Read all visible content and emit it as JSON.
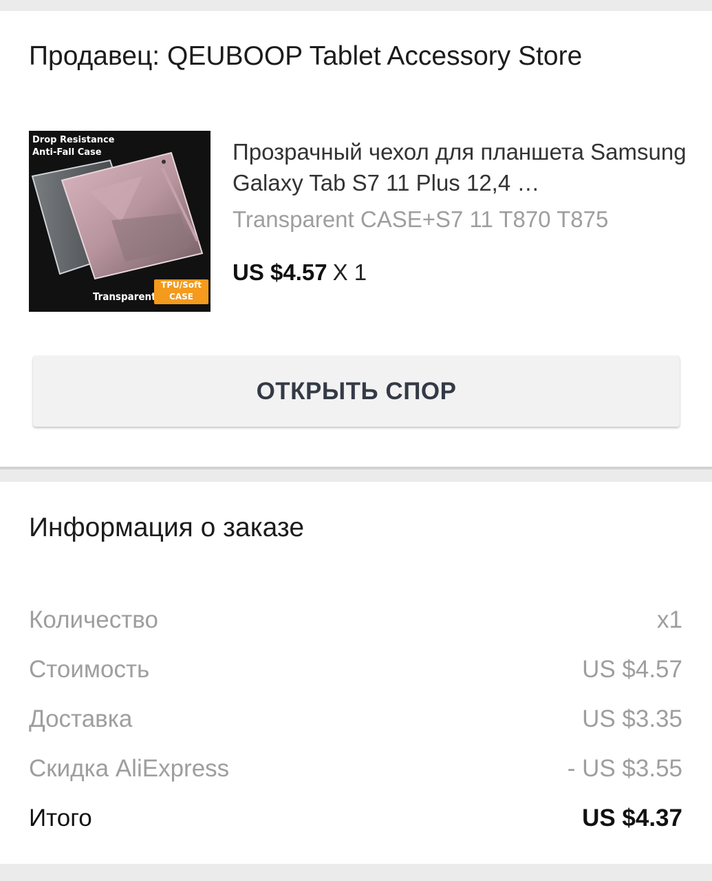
{
  "seller": {
    "label": "Продавец: QEUBOOP Tablet Accessory Store"
  },
  "product": {
    "image_text_top_1": "Drop Resistance",
    "image_text_top_2": "Anti-Fall Case",
    "image_text_bottom": "Transparent",
    "image_badge_1": "TPU/Soft",
    "image_badge_2": "CASE",
    "title": "Прозрачный чехол для планшета Samsung Galaxy Tab S7 11 Plus 12,4 …",
    "variant": "Transparent CASE+S7 11 T870 T875",
    "price": "US $4.57",
    "quantity": "X 1"
  },
  "actions": {
    "dispute_label": "ОТКРЫТЬ СПОР"
  },
  "order_info": {
    "title": "Информация о заказе",
    "rows": [
      {
        "label": "Количество",
        "value": "x1"
      },
      {
        "label": "Стоимость",
        "value": "US $4.57"
      },
      {
        "label": "Доставка",
        "value": "US $3.35"
      },
      {
        "label": "Скидка AliExpress",
        "value": "- US $3.55"
      }
    ],
    "total": {
      "label": "Итого",
      "value": "US $4.37"
    }
  },
  "colors": {
    "background": "#ebebeb",
    "card": "#ffffff",
    "muted_text": "#9e9e9e",
    "button_bg": "#f2f2f2",
    "button_text": "#343a46",
    "badge_orange": "#f49a1c"
  }
}
